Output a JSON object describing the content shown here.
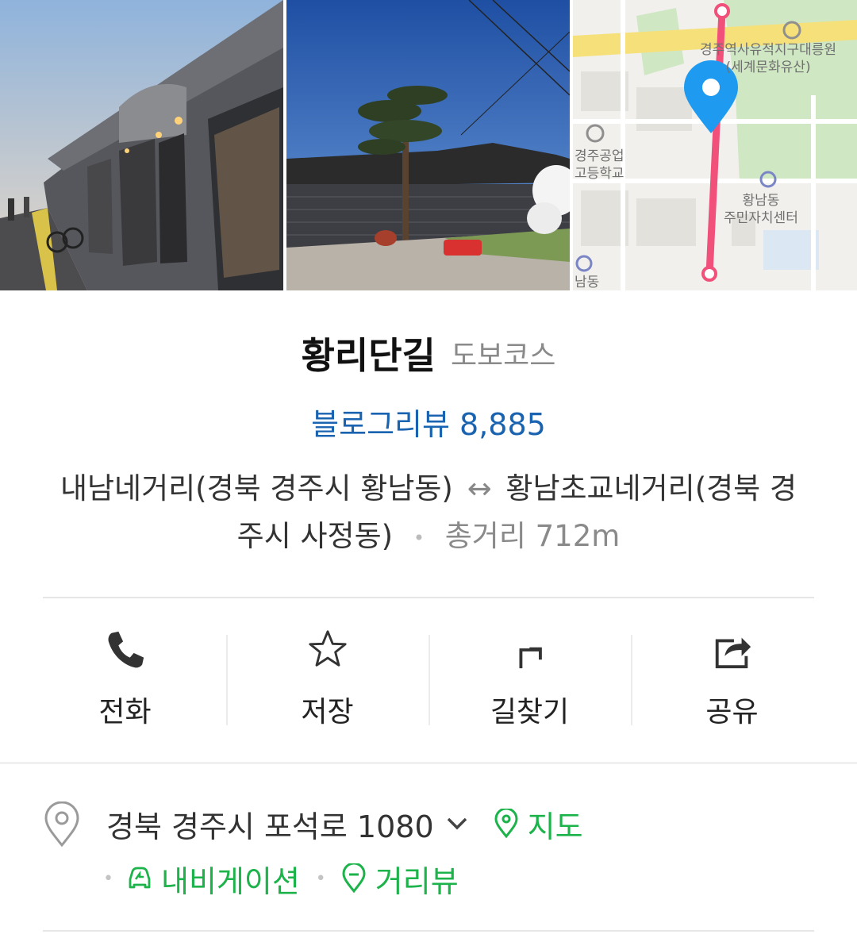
{
  "photos": [
    {
      "name": "street-photo",
      "desc_icon": "storefront-photo"
    },
    {
      "name": "garden-photo",
      "desc_icon": "hanok-garden-photo"
    },
    {
      "name": "map-thumbnail",
      "desc_icon": "map-preview"
    }
  ],
  "map_labels": {
    "heritage_line1": "경주역사유적지구대릉원",
    "heritage_line2": "(세계문화유산)",
    "school_line1": "경주공업",
    "school_line2": "고등학교",
    "center_line1": "황남동",
    "center_line2": "주민자치센터",
    "bottom": "남동"
  },
  "place": {
    "title": "황리단길",
    "category": "도보코스",
    "blog_review": "블로그리뷰 8,885",
    "route_start": "내남네거리(경북 경주시 황남동)",
    "route_arrow": "↔",
    "route_end": "황남초교네거리(경북 경주시 사정동)",
    "dot": "•",
    "distance": "총거리 712m"
  },
  "actions": [
    {
      "label": "전화",
      "icon": "phone-icon"
    },
    {
      "label": "저장",
      "icon": "star-icon"
    },
    {
      "label": "길찾기",
      "icon": "directions-icon"
    },
    {
      "label": "공유",
      "icon": "share-icon"
    }
  ],
  "address": {
    "text": "경북 경주시 포석로 1080",
    "map_link": "지도",
    "navigation_link": "내비게이션",
    "street_view_link": "거리뷰",
    "dot": "•"
  },
  "colors": {
    "review_blue": "#1a63b0",
    "link_green": "#1db34b",
    "map_pin_blue": "#1e9bf0",
    "route_pink": "#f0507a"
  }
}
